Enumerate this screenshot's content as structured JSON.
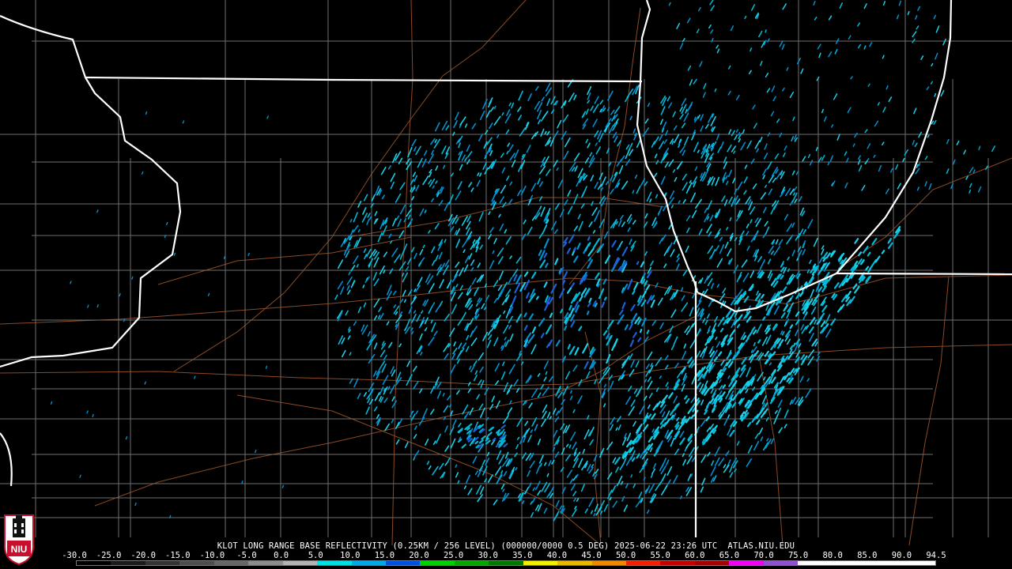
{
  "product": {
    "caption": "KLOT LONG RANGE BASE REFLECTIVITY (0.25KM / 256 LEVEL) (000000/0000 0.5 DEG) 2025-06-22 23:26 UTC  ATLAS.NIU.EDU"
  },
  "logo": {
    "text": "NIU"
  },
  "scale": {
    "labels": [
      "-30.0",
      "-25.0",
      "-20.0",
      "-15.0",
      "-10.0",
      "-5.0",
      "0.0",
      "5.0",
      "10.0",
      "15.0",
      "20.0",
      "25.0",
      "30.0",
      "35.0",
      "40.0",
      "45.0",
      "50.0",
      "55.0",
      "60.0",
      "65.0",
      "70.0",
      "75.0",
      "80.0",
      "85.0",
      "90.0",
      "94.5"
    ],
    "colors": [
      "#000000",
      "#1a1a1a",
      "#333333",
      "#4d4d4d",
      "#666666",
      "#8c8c8c",
      "#b3b3b3",
      "#00e0e0",
      "#00a8e8",
      "#0050e0",
      "#00d000",
      "#00a800",
      "#007800",
      "#f0f000",
      "#e8b800",
      "#f08800",
      "#f02000",
      "#c00000",
      "#a00000",
      "#f000f0",
      "#9050d0",
      "#ffffff",
      "#ffffff",
      "#ffffff",
      "#ffffff"
    ]
  },
  "map": {
    "background": "#000000",
    "state_border_color": "#ffffff",
    "county_line_color": "#6e6e6e",
    "road_color": "#8b4a24",
    "echo_colors": [
      "#00b8d8",
      "#18d0e8",
      "#0090d0",
      "#1c60d8"
    ]
  }
}
